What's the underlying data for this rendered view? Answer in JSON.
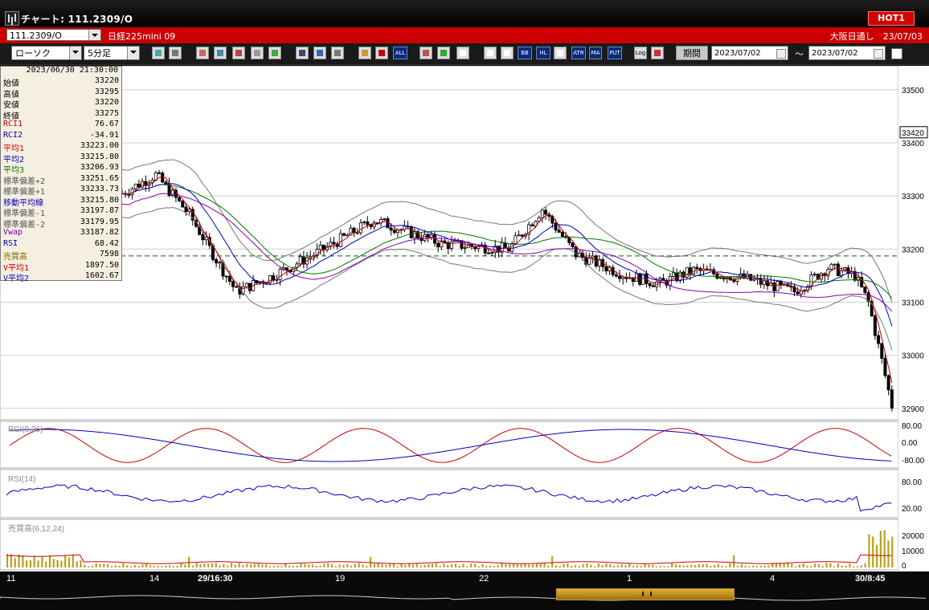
{
  "window": {
    "title": "チャート: 111.2309/O",
    "hot_label": "HOT1"
  },
  "instrument": {
    "symbol": "111.2309/O",
    "name": "日経225mini 09",
    "session": "大阪日通し　23/07/03"
  },
  "toolbar": {
    "chart_type": "ローソク",
    "interval": "5分足",
    "indicator_buttons": [
      "BB",
      "HL",
      "ATR",
      "PUT",
      "ALL",
      "MA",
      "Log"
    ],
    "period_label": "期間",
    "start_date": "2023/07/02",
    "range_separator": "～",
    "end_date": "2023/07/02"
  },
  "data_window": {
    "timestamp": "2023/06/30  21:30:00",
    "rows": [
      {
        "label": "始値",
        "value": "33220",
        "color": "#000000"
      },
      {
        "label": "高値",
        "value": "33295",
        "color": "#000000"
      },
      {
        "label": "安値",
        "value": "33220",
        "color": "#000000"
      },
      {
        "label": "終値",
        "value": "33275",
        "color": "#000000"
      },
      {
        "label": "RCI1",
        "value": "76.67",
        "color": "#cc0000"
      },
      {
        "label": "RCI2",
        "value": "-34.91",
        "color": "#0000bb"
      },
      {
        "label": "平均1",
        "value": "33223.00",
        "color": "#cc0000"
      },
      {
        "label": "平均2",
        "value": "33215.80",
        "color": "#0000bb"
      },
      {
        "label": "平均3",
        "value": "33206.93",
        "color": "#007700"
      },
      {
        "label": "標準偏差+2",
        "value": "33251.65",
        "color": "#555555"
      },
      {
        "label": "標準偏差+1",
        "value": "33233.73",
        "color": "#555555"
      },
      {
        "label": "移動平均線",
        "value": "33215.80",
        "color": "#0000bb"
      },
      {
        "label": "標準偏差-1",
        "value": "33197.87",
        "color": "#555555"
      },
      {
        "label": "標準偏差-2",
        "value": "33179.95",
        "color": "#555555"
      },
      {
        "label": "Vwap",
        "value": "33187.82",
        "color": "#8800aa"
      },
      {
        "label": "RSI",
        "value": "68.42",
        "color": "#0000bb"
      },
      {
        "label": "売買高",
        "value": "7598",
        "color": "#886600"
      },
      {
        "label": "V平均1",
        "value": "1897.50",
        "color": "#cc0000"
      },
      {
        "label": "V平均2",
        "value": "1602.67",
        "color": "#0000bb"
      }
    ]
  },
  "price_axis": {
    "ticks": [
      {
        "value": 33500,
        "label": "33500"
      },
      {
        "value": 33400,
        "label": "33400"
      },
      {
        "value": 33300,
        "label": "33300"
      },
      {
        "value": 33200,
        "label": "33200"
      },
      {
        "value": 33100,
        "label": "33100"
      },
      {
        "value": 33000,
        "label": "33000"
      },
      {
        "value": 32900,
        "label": "32900"
      }
    ],
    "current_price_label": "33420",
    "current_price": 33420
  },
  "rci_panel": {
    "label": "RCI(9,26)",
    "ticks": [
      "80.00",
      "0.00",
      "-80.00"
    ]
  },
  "rsi_panel": {
    "label": "RSI(14)",
    "ticks": [
      "80.00",
      "20.00"
    ]
  },
  "volume_panel": {
    "label": "売買高(6,12,24)",
    "ticks": [
      "20000",
      "10000",
      "0"
    ]
  },
  "time_axis": {
    "labels": [
      "11",
      "14",
      "29/16:30",
      "19",
      "22",
      "1",
      "4",
      "30/8:45"
    ]
  },
  "colors": {
    "up": "#ffffff",
    "down": "#000000",
    "ma1": "#cc0000",
    "ma2": "#0000bb",
    "ma3": "#007700",
    "bb": "#777777",
    "vwap": "#8800aa",
    "volume": "#b8a020",
    "accent": "#cc0000"
  }
}
